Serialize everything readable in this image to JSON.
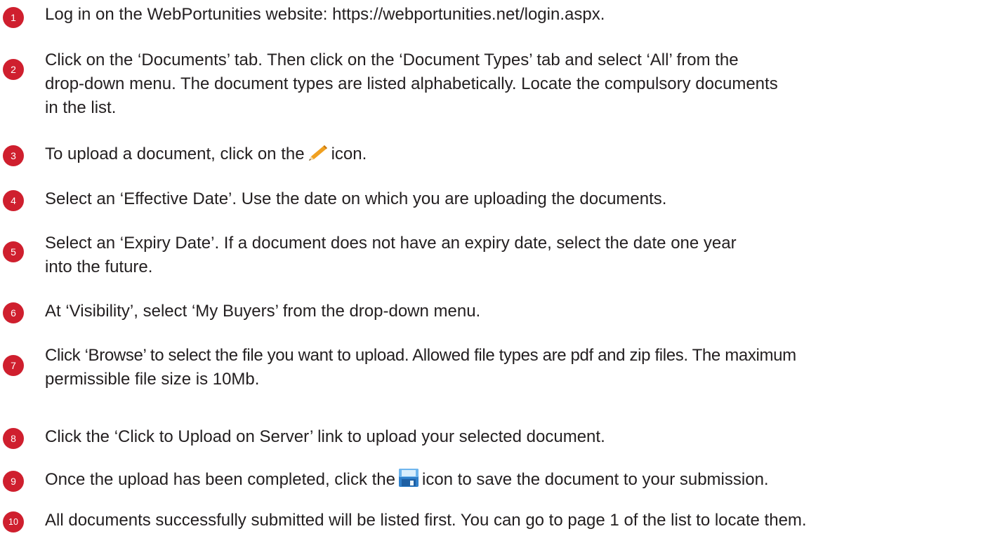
{
  "brand": {
    "accent": "#cf1f2e",
    "text_color": "#231f20"
  },
  "steps": [
    {
      "number": "1",
      "lines": [
        "Log in on the WebPortunities website: https://webportunities.net/login.aspx."
      ]
    },
    {
      "number": "2",
      "lines": [
        "Click on the ‘Documents’ tab. Then click on the ‘Document Types’ tab and select ‘All’ from the",
        "drop-down menu. The document types are listed alphabetically. Locate the compulsory documents",
        "in the list."
      ]
    },
    {
      "number": "3",
      "before_icon": "To upload a document, click on the",
      "icon": "pencil-icon",
      "after_icon": "icon."
    },
    {
      "number": "4",
      "lines": [
        "Select an ‘Effective Date’. Use the date on which you are uploading the documents."
      ]
    },
    {
      "number": "5",
      "lines": [
        "Select an ‘Expiry Date’. If a document does not have an expiry date, select the date one year",
        "into the future."
      ]
    },
    {
      "number": "6",
      "lines": [
        "At ‘Visibility’, select ‘My Buyers’ from the drop-down menu."
      ]
    },
    {
      "number": "7",
      "lines": [
        "Click ‘Browse’ to select the file you want to upload. Allowed file types are pdf and zip files. The maximum",
        "permissible file size is 10Mb."
      ]
    },
    {
      "number": "8",
      "lines": [
        "Click the ‘Click to Upload on Server’ link to upload your selected document."
      ]
    },
    {
      "number": "9",
      "before_icon": "Once the upload has been completed, click the",
      "icon": "save-icon",
      "after_icon": "icon to save the document to your submission."
    },
    {
      "number": "10",
      "lines": [
        "All documents successfully submitted will be listed first. You can go to page 1 of the list to locate them."
      ]
    }
  ]
}
